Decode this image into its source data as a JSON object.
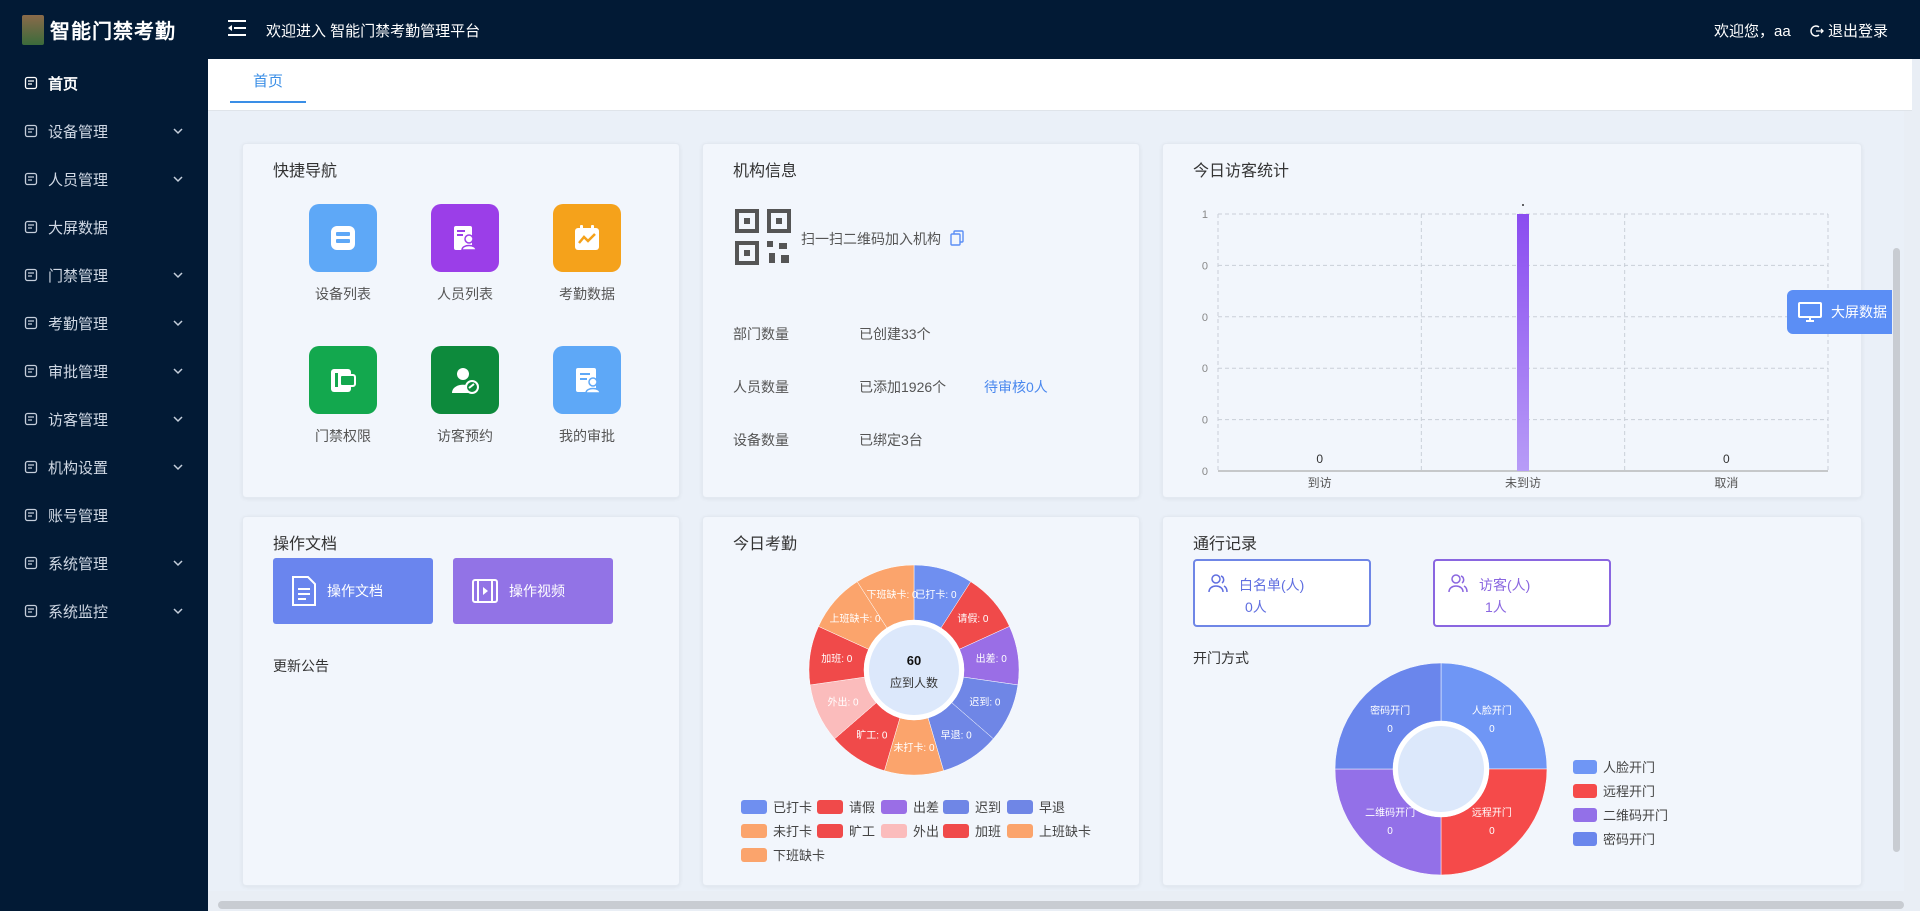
{
  "header": {
    "app_title": "智能门禁考勤",
    "welcome": "欢迎进入 智能门禁考勤管理平台",
    "user_greeting": "欢迎您，aa",
    "logout": "退出登录"
  },
  "sidebar": {
    "items": [
      {
        "label": "首页",
        "icon": "home-icon",
        "expandable": false
      },
      {
        "label": "设备管理",
        "icon": "device-icon",
        "expandable": true
      },
      {
        "label": "人员管理",
        "icon": "person-card-icon",
        "expandable": true
      },
      {
        "label": "大屏数据",
        "icon": "chart-icon",
        "expandable": false
      },
      {
        "label": "门禁管理",
        "icon": "door-icon",
        "expandable": true
      },
      {
        "label": "考勤管理",
        "icon": "attendance-icon",
        "expandable": true
      },
      {
        "label": "审批管理",
        "icon": "approval-icon",
        "expandable": true
      },
      {
        "label": "访客管理",
        "icon": "visitor-icon",
        "expandable": true
      },
      {
        "label": "机构设置",
        "icon": "org-icon",
        "expandable": true
      },
      {
        "label": "账号管理",
        "icon": "account-icon",
        "expandable": false
      },
      {
        "label": "系统管理",
        "icon": "settings-icon",
        "expandable": true
      },
      {
        "label": "系统监控",
        "icon": "monitor-icon",
        "expandable": true
      }
    ]
  },
  "tabs": [
    {
      "label": "首页"
    }
  ],
  "quick_nav": {
    "title": "快捷导航",
    "items": [
      {
        "label": "设备列表",
        "color": "#5ea8f7"
      },
      {
        "label": "人员列表",
        "color": "#9b3ee8"
      },
      {
        "label": "考勤数据",
        "color": "#f5a21b"
      },
      {
        "label": "门禁权限",
        "color": "#13a84e"
      },
      {
        "label": "访客预约",
        "color": "#0d8a3c"
      },
      {
        "label": "我的审批",
        "color": "#5ea8f7"
      }
    ]
  },
  "org_info": {
    "title": "机构信息",
    "scan_text": "扫一扫二维码加入机构",
    "rows": [
      {
        "label": "部门数量",
        "value": "已创建33个",
        "extra": ""
      },
      {
        "label": "人员数量",
        "value": "已添加1926个",
        "extra": "待审核0人"
      },
      {
        "label": "设备数量",
        "value": "已绑定3台",
        "extra": ""
      }
    ]
  },
  "visitor_stats": {
    "title": "今日访客统计"
  },
  "docs": {
    "title": "操作文档",
    "doc_button": "操作文档",
    "video_button": "操作视频",
    "announcement": "更新公告"
  },
  "attendance": {
    "title": "今日考勤",
    "center_value": "60",
    "center_label": "应到人数"
  },
  "pass_records": {
    "title": "通行记录",
    "whitelist_label": "白名单(人)",
    "whitelist_value": "0人",
    "visitor_label": "访客(人)",
    "visitor_value": "1人",
    "open_method_title": "开门方式"
  },
  "float_button": "大屏数据",
  "chart_data": [
    {
      "type": "bar",
      "title": "今日访客统计",
      "categories": [
        "到访",
        "未到访",
        "取消"
      ],
      "values": [
        0,
        1,
        0
      ],
      "data_labels": [
        "0",
        "",
        "0"
      ],
      "yticks": [
        "0",
        "0",
        "0",
        "0",
        "0",
        "1"
      ],
      "ylim": [
        0,
        1
      ],
      "grid": true,
      "color": "#8b5cf6"
    },
    {
      "type": "pie",
      "title": "今日考勤",
      "categories": [
        "已打卡",
        "请假",
        "出差",
        "迟到",
        "早退",
        "未打卡",
        "旷工",
        "外出",
        "加班",
        "上班缺卡",
        "下班缺卡"
      ],
      "values": [
        0,
        0,
        0,
        0,
        0,
        0,
        0,
        0,
        0,
        0,
        0
      ],
      "colors": [
        "#6f8ff0",
        "#f04a4a",
        "#9a6ee6",
        "#6f86e6",
        "#6f86e6",
        "#fba46c",
        "#f04a4a",
        "#fbbcbc",
        "#f04a4a",
        "#fba46c",
        "#fba46c"
      ],
      "legend": "bottom"
    },
    {
      "type": "pie",
      "title": "开门方式",
      "categories": [
        "人脸开门",
        "远程开门",
        "二维码开门",
        "密码开门"
      ],
      "values": [
        0,
        0,
        0,
        0
      ],
      "colors": [
        "#6f96f5",
        "#f54a4a",
        "#9370e8",
        "#6a86ec"
      ],
      "legend": "right"
    }
  ]
}
